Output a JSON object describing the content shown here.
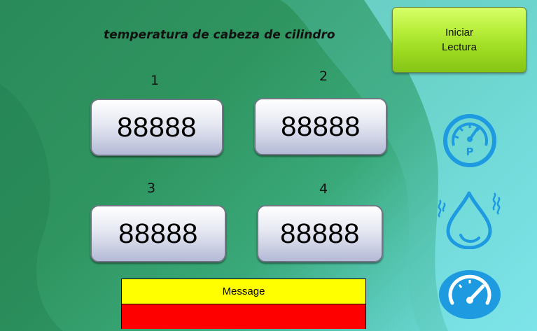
{
  "title": "temperatura de cabeza de cilindro",
  "start_button": {
    "line1": "Iniciar",
    "line2": "Lectura"
  },
  "cylinders": [
    {
      "label": "1",
      "value": "88888"
    },
    {
      "label": "2",
      "value": "88888"
    },
    {
      "label": "3",
      "value": "88888"
    },
    {
      "label": "4",
      "value": "88888"
    }
  ],
  "message": {
    "label": "Message",
    "status_colors": {
      "top": "#ffff00",
      "bottom": "#ff0000"
    }
  },
  "icons": [
    "pressure-gauge-icon",
    "water-drop-humidity-icon",
    "speedometer-icon"
  ],
  "colors": {
    "accent_icon": "#1e9be0",
    "start_button": "#9ad81f"
  }
}
